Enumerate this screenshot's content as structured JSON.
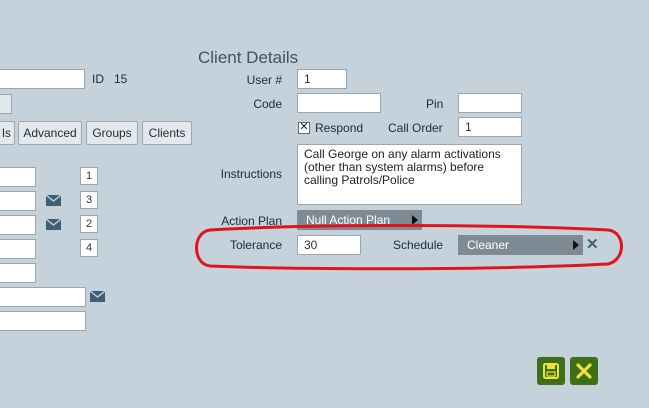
{
  "page_title": "Client Details",
  "left": {
    "id_label": "ID",
    "id_value": "15",
    "tabs": [
      "ls",
      "Advanced",
      "Groups",
      "Clients"
    ],
    "order_numbers": [
      "1",
      "3",
      "2",
      "4"
    ]
  },
  "form": {
    "user_label": "User #",
    "user_value": "1",
    "code_label": "Code",
    "code_value": "",
    "pin_label": "Pin",
    "pin_value": "",
    "respond_label": "Respond",
    "respond_checked_glyph": "✕",
    "call_order_label": "Call Order",
    "call_order_value": "1",
    "instructions_label": "Instructions",
    "instructions_value": "Call George on any alarm activations (other than system alarms) before calling Patrols/Police",
    "action_plan_label": "Action Plan",
    "action_plan_value": "Null Action Plan",
    "tolerance_label": "Tolerance",
    "tolerance_value": "30",
    "schedule_label": "Schedule",
    "schedule_value": "Cleaner",
    "clear_glyph": "✕"
  },
  "colors": {
    "background": "#c5d2db",
    "highlight_ring": "#e0141e",
    "save_button": "#3d6e18",
    "cancel_button": "#3d6e18"
  },
  "icons": {
    "envelope": "envelope-icon",
    "save": "save-icon",
    "cancel": "cancel-icon"
  }
}
